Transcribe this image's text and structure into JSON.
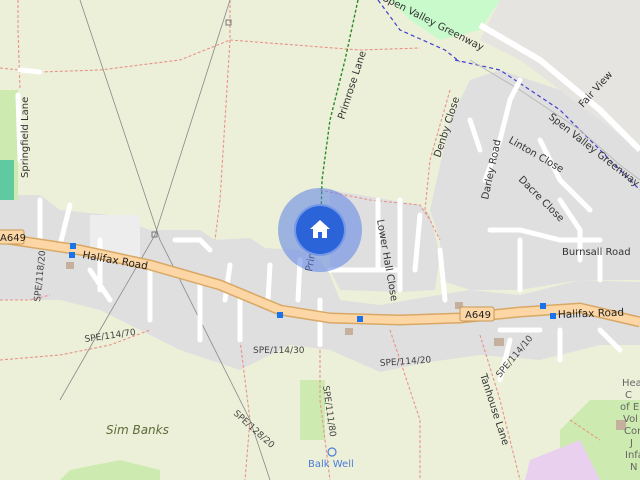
{
  "map": {
    "road_labels": {
      "a649_west": "A649",
      "a649_east": "A649",
      "halifax_road_west": "Halifax Road",
      "halifax_road_east": "Halifax Road",
      "springfield_lane": "Springfield Lane",
      "primrose_lane_north": "Primrose Lane",
      "primrose_lane_south": "Primrose",
      "lower_hall_close": "Lower Hall Close",
      "spen_valley_greenway_top": "Spen Valley Greenway",
      "spen_valley_greenway_right": "Spen Valley Greenway",
      "fair_view": "Fair View",
      "denby_close": "Denby Close",
      "linton_close": "Linton Close",
      "darley_road": "Darley Road",
      "dacre_close": "Dacre Close",
      "burnsall_road": "Burnsall Road",
      "tanhouse_lane": "Tanhouse Lane"
    },
    "path_labels": {
      "spe_118_20": "SPE/118/20",
      "spe_114_70": "SPE/114/70",
      "spe_114_30": "SPE/114/30",
      "spe_114_20": "SPE/114/20",
      "spe_114_10": "SPE/114/10",
      "spe_128_20": "SPE/128/20",
      "spe_111_80": "SPE/111/80"
    },
    "place_labels": {
      "sim_banks": "Sim Banks",
      "balk_well": "Balk Well"
    },
    "poi_partial_text": [
      "Hea",
      "C",
      "of E",
      "Vol",
      "Cor",
      "J",
      "Infa",
      "N"
    ],
    "colors": {
      "background": "#edf0d8",
      "residential": "#e0dfdf",
      "road_primary": "#fcd6a4",
      "road_primary_casing": "#d9a865",
      "road_minor": "#ffffff",
      "path_red_dashed": "#e8928a",
      "path_green_dashed": "#2a8a2a",
      "railway_blue_dashed": "#4040d0",
      "park": "#c8facc",
      "grass": "#cdebb0",
      "bus_stop": "#1a73e8",
      "location_marker": "#2b63d9",
      "location_halo": "#6f93e8"
    },
    "location_marker": {
      "icon": "home-icon"
    }
  }
}
